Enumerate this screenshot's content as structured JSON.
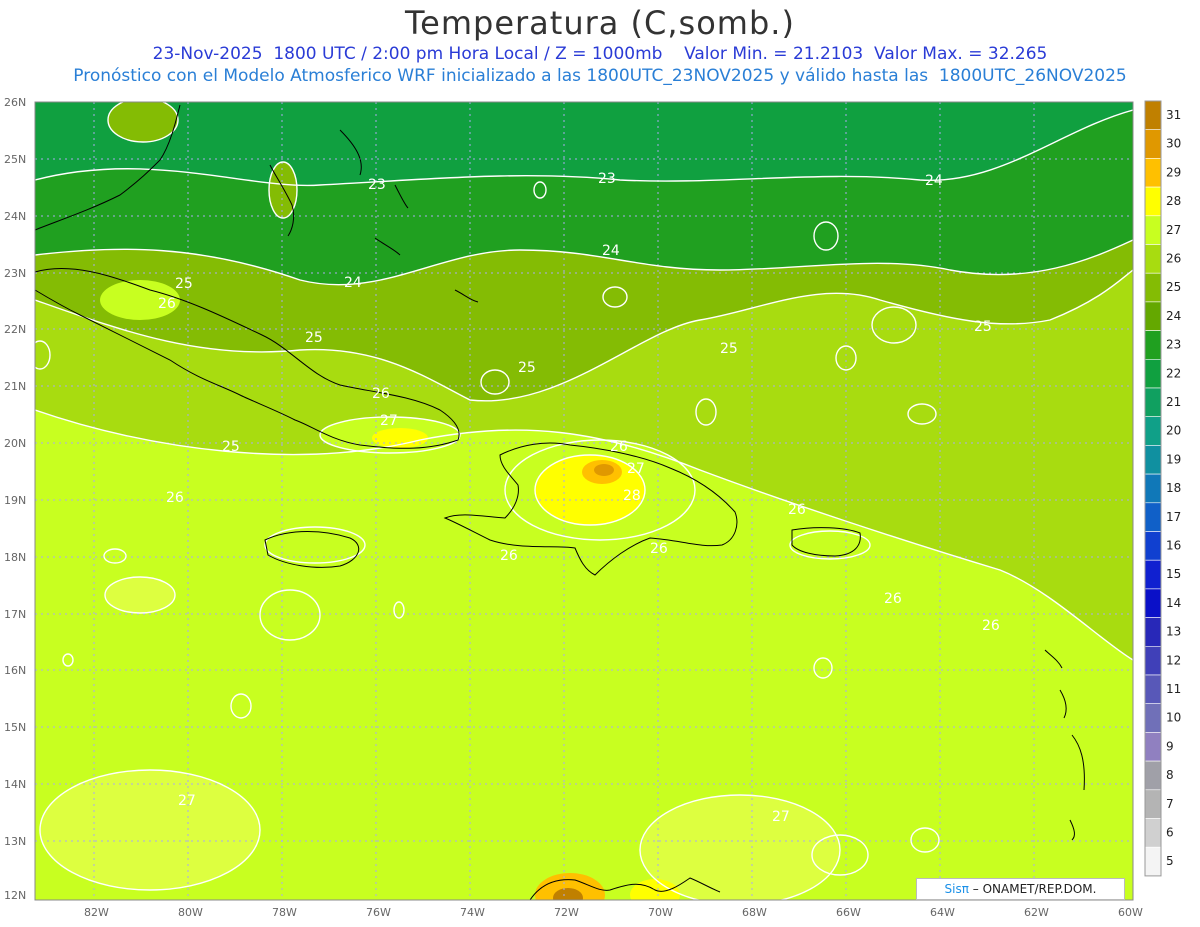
{
  "header": {
    "title": "Temperatura (C,somb.)",
    "line1": "23-Nov-2025  1800 UTC / 2:00 pm Hora Local / Z = 1000mb    Valor Min. = 21.2103  Valor Max. = 32.265",
    "line2": "Pronóstico con el Modelo Atmosferico WRF inicializado a las 1800UTC_23NOV2025 y válido hasta las  1800UTC_26NOV2025"
  },
  "axes": {
    "lat_labels": [
      "26N",
      "25N",
      "24N",
      "23N",
      "22N",
      "21N",
      "20N",
      "19N",
      "18N",
      "17N",
      "16N",
      "15N",
      "14N",
      "13N",
      "12N"
    ],
    "lon_labels": [
      "82W",
      "80W",
      "78W",
      "76W",
      "74W",
      "72W",
      "70W",
      "68W",
      "66W",
      "64W",
      "62W",
      "60W"
    ]
  },
  "contour_labels": [
    {
      "text": "25",
      "id": "a"
    },
    {
      "text": "26",
      "id": "b"
    },
    {
      "text": "23",
      "id": "c"
    },
    {
      "text": "23",
      "id": "d"
    },
    {
      "text": "24",
      "id": "e"
    },
    {
      "text": "24",
      "id": "f"
    },
    {
      "text": "24",
      "id": "g"
    },
    {
      "text": "25",
      "id": "h"
    },
    {
      "text": "25",
      "id": "i"
    },
    {
      "text": "25",
      "id": "j"
    },
    {
      "text": "25",
      "id": "k"
    },
    {
      "text": "26",
      "id": "l"
    },
    {
      "text": "27",
      "id": "m"
    },
    {
      "text": "25",
      "id": "n"
    },
    {
      "text": "26",
      "id": "o"
    },
    {
      "text": "26",
      "id": "p"
    },
    {
      "text": "27",
      "id": "q"
    },
    {
      "text": "28",
      "id": "r"
    },
    {
      "text": "26",
      "id": "s"
    },
    {
      "text": "26",
      "id": "t"
    },
    {
      "text": "26",
      "id": "u"
    },
    {
      "text": "26",
      "id": "v"
    },
    {
      "text": "26",
      "id": "w"
    },
    {
      "text": "27",
      "id": "x"
    },
    {
      "text": "27",
      "id": "y"
    }
  ],
  "colorbar": {
    "labels": [
      "31",
      "30",
      "29",
      "28",
      "27",
      "26",
      "25",
      "24",
      "23",
      "22",
      "21",
      "20",
      "19",
      "18",
      "17",
      "16",
      "15",
      "14",
      "13",
      "12",
      "11",
      "10",
      "9",
      "8",
      "7",
      "6",
      "5"
    ],
    "colors": [
      "#c08000",
      "#e09800",
      "#ffc000",
      "#ffff00",
      "#c8ff20",
      "#a8dc10",
      "#84bc04",
      "#64a800",
      "#20a020",
      "#10a040",
      "#10a060",
      "#10a088",
      "#1090a0",
      "#1078b8",
      "#1060c8",
      "#1040d0",
      "#1020d0",
      "#0a10c8",
      "#2828b8",
      "#4040b8",
      "#5858b8",
      "#7070b8",
      "#9080c0",
      "#a0a0a8",
      "#b4b4b4",
      "#d0d0d0",
      "#f4f4f4"
    ]
  },
  "credit": {
    "sis": "Sisπ",
    "rest": " – ONAMET/REP.DOM."
  }
}
